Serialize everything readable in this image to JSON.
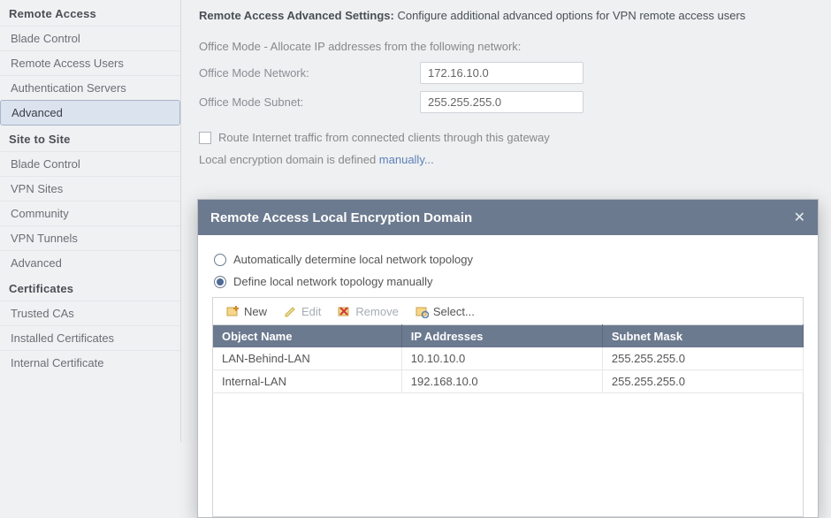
{
  "sidebar": {
    "groups": [
      {
        "title": "Remote Access",
        "items": [
          {
            "label": "Blade Control",
            "selected": false
          },
          {
            "label": "Remote Access Users",
            "selected": false
          },
          {
            "label": "Authentication Servers",
            "selected": false
          },
          {
            "label": "Advanced",
            "selected": true
          }
        ]
      },
      {
        "title": "Site to Site",
        "items": [
          {
            "label": "Blade Control",
            "selected": false
          },
          {
            "label": "VPN Sites",
            "selected": false
          },
          {
            "label": "Community",
            "selected": false
          },
          {
            "label": "VPN Tunnels",
            "selected": false
          },
          {
            "label": "Advanced",
            "selected": false
          }
        ]
      },
      {
        "title": "Certificates",
        "items": [
          {
            "label": "Trusted CAs",
            "selected": false
          },
          {
            "label": "Installed Certificates",
            "selected": false
          },
          {
            "label": "Internal Certificate",
            "selected": false
          }
        ]
      }
    ]
  },
  "page": {
    "title_bold": "Remote Access Advanced Settings:",
    "title_rest": " Configure additional advanced options for VPN remote access users",
    "office_mode_label": "Office Mode - Allocate IP addresses from the following network:",
    "fields": {
      "network_label": "Office Mode Network:",
      "network_value": "172.16.10.0",
      "subnet_label": "Office Mode Subnet:",
      "subnet_value": "255.255.255.0"
    },
    "route_checkbox": "Route Internet traffic from connected clients through this gateway",
    "local_enc_prefix": "Local encryption domain is defined ",
    "local_enc_link": "manually...",
    "bg_link_1": "ually",
    "bg_link_2": "ually"
  },
  "modal": {
    "title": "Remote Access Local Encryption Domain",
    "radio_auto": "Automatically determine local network topology",
    "radio_manual": "Define local network topology manually",
    "toolbar": {
      "new": "New",
      "edit": "Edit",
      "remove": "Remove",
      "select": "Select..."
    },
    "table": {
      "cols": [
        "Object Name",
        "IP Addresses",
        "Subnet Mask"
      ],
      "rows": [
        {
          "name": "LAN-Behind-LAN",
          "ip": "10.10.10.0",
          "mask": "255.255.255.0"
        },
        {
          "name": "Internal-LAN",
          "ip": "192.168.10.0",
          "mask": "255.255.255.0"
        }
      ]
    }
  }
}
